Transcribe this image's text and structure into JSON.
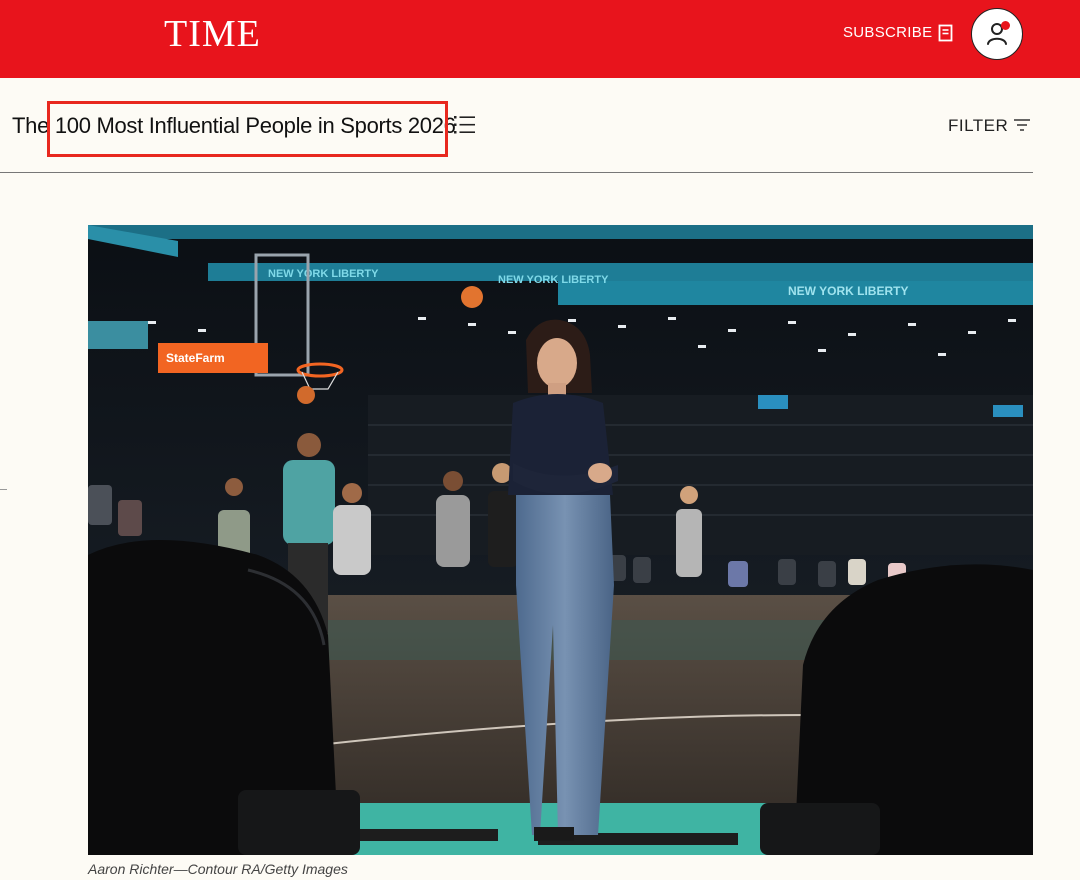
{
  "header": {
    "logo": "TIME",
    "subscribe_label": "SUBSCRIBE",
    "brand_color": "#e8141c"
  },
  "title_row": {
    "title": "The 100 Most Influential People in Sports 2026",
    "filter_label": "FILTER"
  },
  "hero": {
    "banner_text": "NEW YORK LIBERTY",
    "sponsor_text": "StateFarm",
    "caption": "Aaron Richter—Contour RA/Getty Images"
  }
}
